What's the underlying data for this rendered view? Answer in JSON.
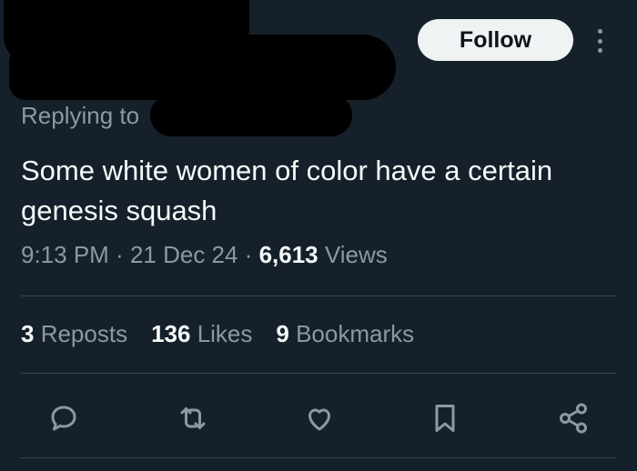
{
  "header": {
    "follow_label": "Follow"
  },
  "reply": {
    "prefix": "Replying to"
  },
  "tweet": {
    "text": "Some white women of color have a certain genesis squash"
  },
  "meta": {
    "time": "9:13 PM",
    "sep1": " · ",
    "date": "21 Dec 24",
    "sep2": " · ",
    "views_count": "6,613",
    "views_label": " Views"
  },
  "stats": {
    "reposts_count": "3",
    "reposts_label": " Reposts",
    "likes_count": "136",
    "likes_label": " Likes",
    "bookmarks_count": "9",
    "bookmarks_label": " Bookmarks"
  },
  "colors": {
    "background": "#15202b",
    "text_primary": "#f7f9f9",
    "text_secondary": "#8b98a5",
    "divider": "#38444d",
    "follow_bg": "#eff3f4"
  },
  "icons": [
    "more-icon",
    "reply-icon",
    "repost-icon",
    "like-icon",
    "bookmark-icon",
    "share-icon"
  ]
}
